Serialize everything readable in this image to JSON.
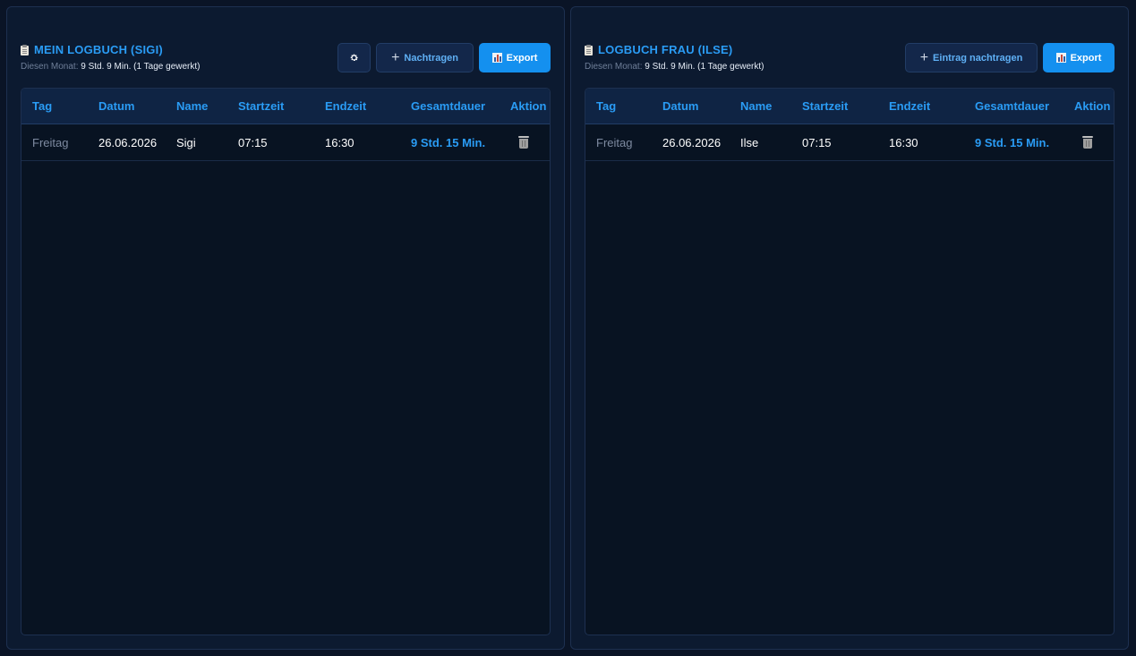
{
  "left": {
    "title": "MEIN LOGBUCH (SIGI)",
    "subtitle_label": "Diesen Monat:",
    "subtitle_value": "9 Std. 9 Min. (1 Tage gewerkt)",
    "add_label": "Nachtragen",
    "export_label": "Export",
    "columns": [
      "Tag",
      "Datum",
      "Name",
      "Startzeit",
      "Endzeit",
      "Gesamtdauer",
      "Aktion"
    ],
    "rows": [
      {
        "tag": "Freitag",
        "datum": "26.06.2026",
        "name": "Sigi",
        "start": "07:15",
        "end": "16:30",
        "dauer": "9 Std. 15 Min."
      }
    ]
  },
  "right": {
    "title": "LOGBUCH FRAU (ILSE)",
    "subtitle_label": "Diesen Monat:",
    "subtitle_value": "9 Std. 9 Min. (1 Tage gewerkt)",
    "add_label": "Eintrag nachtragen",
    "export_label": "Export",
    "columns": [
      "Tag",
      "Datum",
      "Name",
      "Startzeit",
      "Endzeit",
      "Gesamtdauer",
      "Aktion"
    ],
    "rows": [
      {
        "tag": "Freitag",
        "datum": "26.06.2026",
        "name": "Ilse",
        "start": "07:15",
        "end": "16:30",
        "dauer": "9 Std. 15 Min."
      }
    ]
  },
  "icons": {
    "gear": "gear-icon",
    "plus": "plus-icon",
    "export": "bar-chart-icon",
    "title": "clipboard-icon",
    "delete": "trash-icon"
  },
  "colors": {
    "accent": "#2a9cf5",
    "primary_button": "#1490ef",
    "panel_bg": "#0c1a30",
    "table_bg": "#081322"
  }
}
